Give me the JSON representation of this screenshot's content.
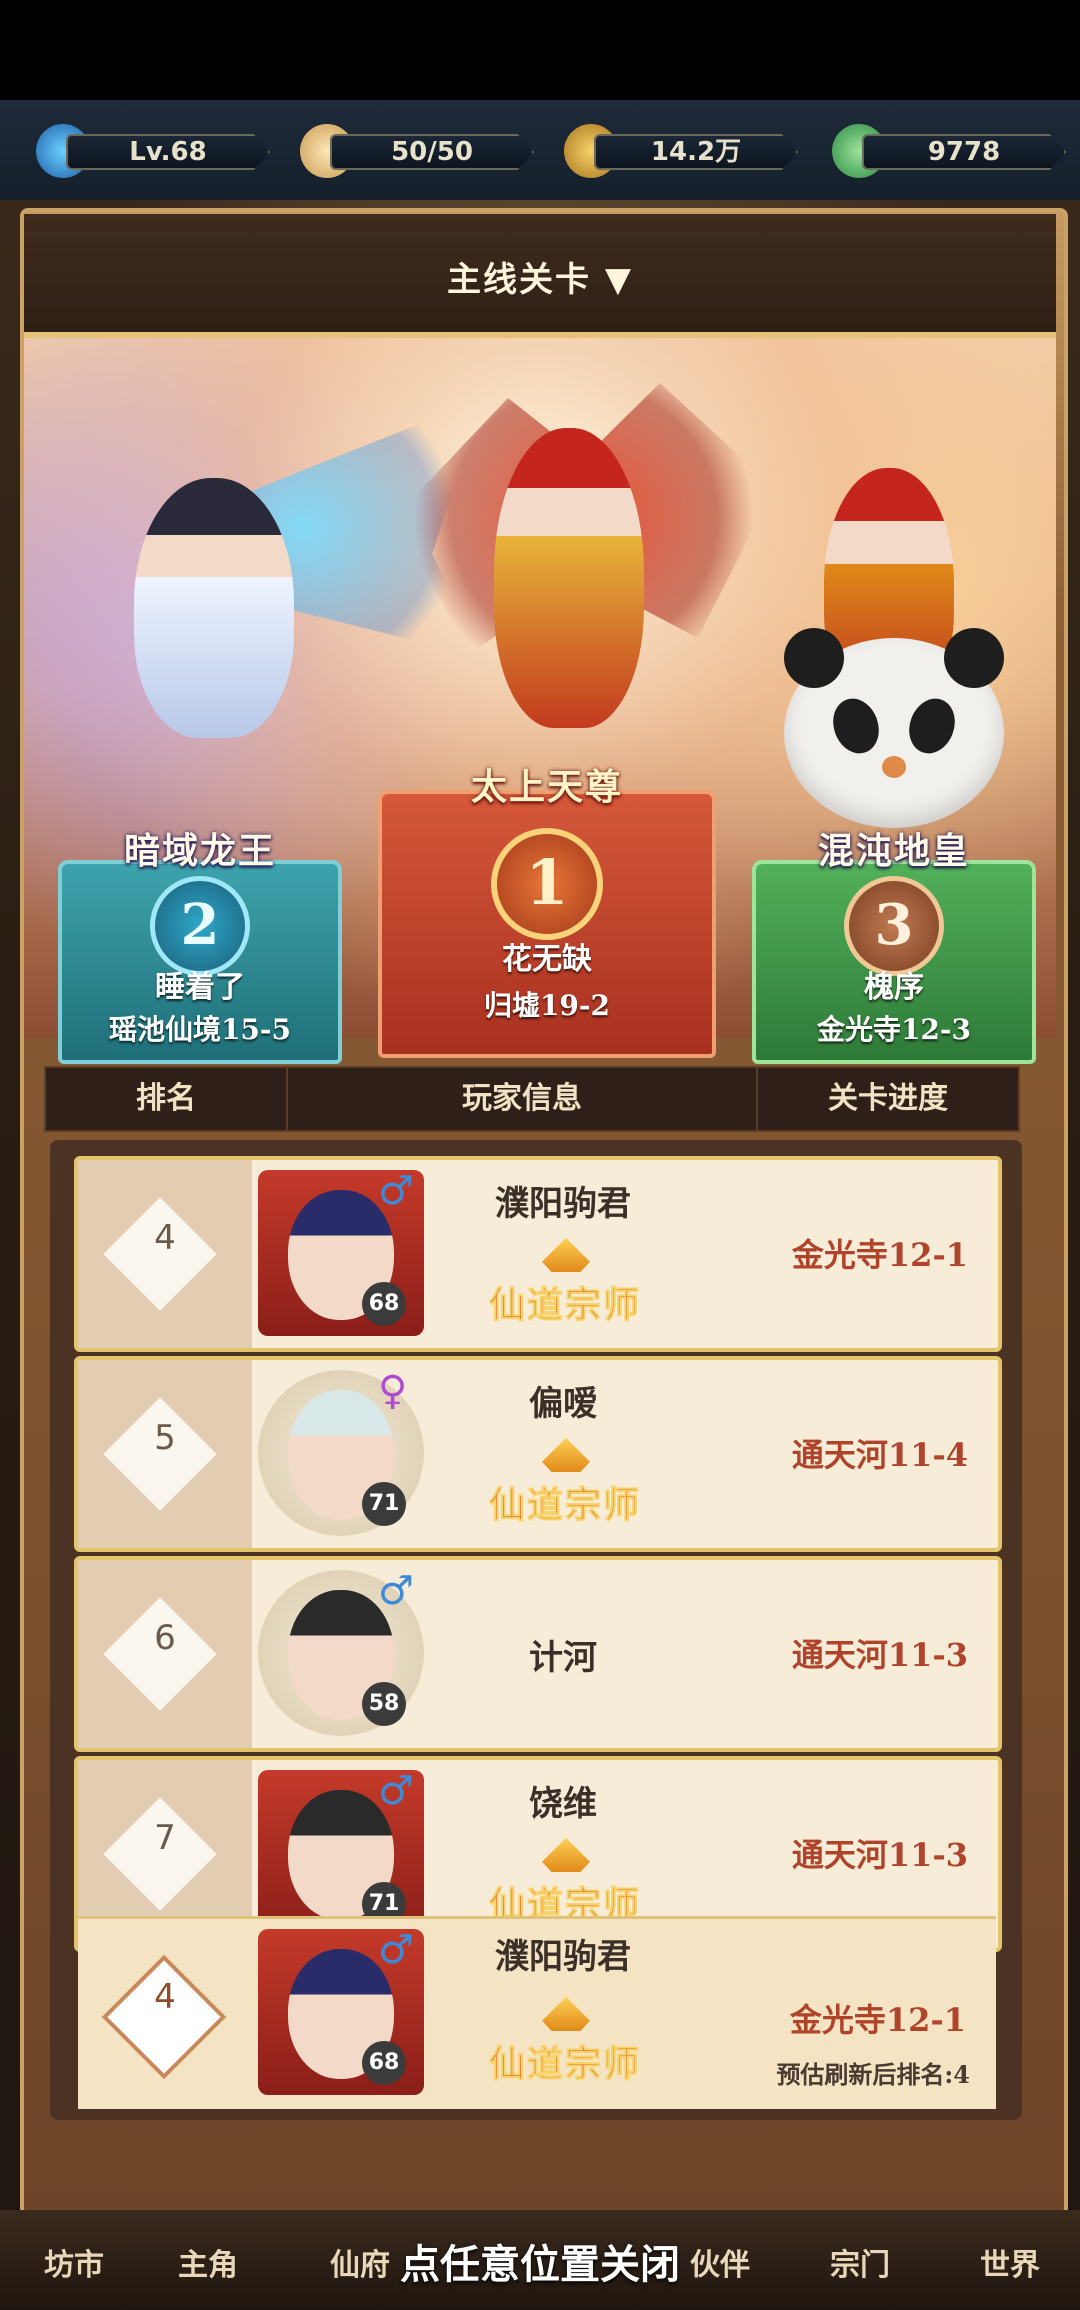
{
  "resources": {
    "level": "Lv.68",
    "stamina": "50/50",
    "coins": "14.2万",
    "jade": "9778"
  },
  "header": {
    "title": "主线关卡 ▼"
  },
  "podium": {
    "second": {
      "title": "暗域龙王",
      "rank": "2",
      "name": "睡着了",
      "progress": "瑶池仙境15-5"
    },
    "first": {
      "title": "太上天尊",
      "rank": "1",
      "name": "花无缺",
      "progress": "归墟19-2"
    },
    "third": {
      "title": "混沌地皇",
      "rank": "3",
      "name": "槐序",
      "progress": "金光寺12-3"
    }
  },
  "columns": {
    "rank": "排名",
    "player": "玩家信息",
    "progress": "关卡进度"
  },
  "rows": [
    {
      "rank": "4",
      "name": "濮阳驹君",
      "gender": "♂",
      "level": "68",
      "title": "仙道宗师",
      "progress": "金光寺12-1"
    },
    {
      "rank": "5",
      "name": "偏嗳",
      "gender": "♀",
      "level": "71",
      "title": "仙道宗师",
      "progress": "通天河11-4"
    },
    {
      "rank": "6",
      "name": "计河",
      "gender": "♂",
      "level": "58",
      "title": "",
      "progress": "通天河11-3"
    },
    {
      "rank": "7",
      "name": "饶维",
      "gender": "♂",
      "level": "71",
      "title": "仙道宗师",
      "progress": "通天河11-3"
    }
  ],
  "me": {
    "rank": "4",
    "name": "濮阳驹君",
    "gender": "♂",
    "level": "68",
    "title": "仙道宗师",
    "progress": "金光寺12-1",
    "estimate": "预估刷新后排名:4"
  },
  "nav": {
    "items": [
      "坊市",
      "主角",
      "仙府",
      "伙伴",
      "宗门",
      "世界"
    ]
  },
  "close_hint": "点任意位置关闭",
  "colors": {
    "gold": "#e4c46a",
    "first_red": "#c8452e",
    "second_teal": "#2f8c98",
    "third_green": "#3f9a4a"
  }
}
